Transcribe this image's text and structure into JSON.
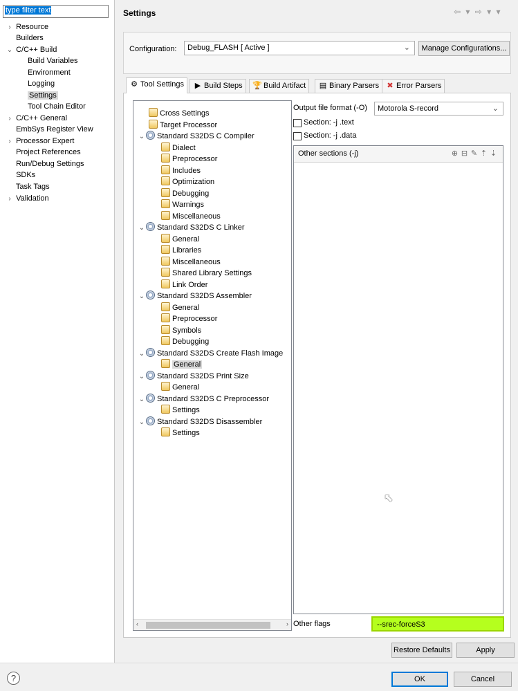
{
  "left_nav": {
    "filter": {
      "value": "type filter text"
    },
    "items": [
      {
        "label": "Resource",
        "chevron": "›"
      },
      {
        "label": "Builders",
        "chevron": ""
      },
      {
        "label": "C/C++ Build",
        "chevron": "⌄"
      },
      {
        "label": "Build Variables",
        "chevron": ""
      },
      {
        "label": "Environment",
        "chevron": ""
      },
      {
        "label": "Logging",
        "chevron": ""
      },
      {
        "label": "Settings",
        "chevron": ""
      },
      {
        "label": "Tool Chain Editor",
        "chevron": ""
      },
      {
        "label": "C/C++ General",
        "chevron": "›"
      },
      {
        "label": "EmbSys Register View",
        "chevron": ""
      },
      {
        "label": "Processor Expert",
        "chevron": "›"
      },
      {
        "label": "Project References",
        "chevron": ""
      },
      {
        "label": "Run/Debug Settings",
        "chevron": ""
      },
      {
        "label": "SDKs",
        "chevron": ""
      },
      {
        "label": "Task Tags",
        "chevron": ""
      },
      {
        "label": "Validation",
        "chevron": "›"
      }
    ]
  },
  "header": {
    "title": "Settings",
    "nav_arrows": "⇦ ▾ ⇨ ▾ ▾"
  },
  "configuration": {
    "label": "Configuration:",
    "value": "Debug_FLASH  [ Active ]",
    "caret": "⌄",
    "manage_label": "Manage Configurations..."
  },
  "tabs": [
    {
      "label": "Tool Settings",
      "icon": "⚙"
    },
    {
      "label": "Build Steps",
      "icon": "▶"
    },
    {
      "label": "Build Artifact",
      "icon": "🏆"
    },
    {
      "label": "Binary Parsers",
      "icon": "▤"
    },
    {
      "label": "Error Parsers",
      "icon": "✖"
    }
  ],
  "tree": {
    "rows": [
      {
        "label": "Cross Settings",
        "chevron": ""
      },
      {
        "label": "Target Processor",
        "chevron": ""
      },
      {
        "label": "Standard S32DS C Compiler",
        "chevron": "⌄"
      },
      {
        "label": "Dialect",
        "chevron": ""
      },
      {
        "label": "Preprocessor",
        "chevron": ""
      },
      {
        "label": "Includes",
        "chevron": ""
      },
      {
        "label": "Optimization",
        "chevron": ""
      },
      {
        "label": "Debugging",
        "chevron": ""
      },
      {
        "label": "Warnings",
        "chevron": ""
      },
      {
        "label": "Miscellaneous",
        "chevron": ""
      },
      {
        "label": "Standard S32DS C Linker",
        "chevron": "⌄"
      },
      {
        "label": "General",
        "chevron": ""
      },
      {
        "label": "Libraries",
        "chevron": ""
      },
      {
        "label": "Miscellaneous",
        "chevron": ""
      },
      {
        "label": "Shared Library Settings",
        "chevron": ""
      },
      {
        "label": "Link Order",
        "chevron": ""
      },
      {
        "label": "Standard S32DS Assembler",
        "chevron": "⌄"
      },
      {
        "label": "General",
        "chevron": ""
      },
      {
        "label": "Preprocessor",
        "chevron": ""
      },
      {
        "label": "Symbols",
        "chevron": ""
      },
      {
        "label": "Debugging",
        "chevron": ""
      },
      {
        "label": "Standard S32DS Create Flash Image",
        "chevron": "⌄"
      },
      {
        "label": "General",
        "chevron": ""
      },
      {
        "label": "Standard S32DS Print Size",
        "chevron": "⌄"
      },
      {
        "label": "General",
        "chevron": ""
      },
      {
        "label": "Standard S32DS C Preprocessor",
        "chevron": "⌄"
      },
      {
        "label": "Settings",
        "chevron": ""
      },
      {
        "label": "Standard S32DS Disassembler",
        "chevron": "⌄"
      },
      {
        "label": "Settings",
        "chevron": ""
      }
    ],
    "scroll_left": "‹",
    "scroll_right": "›"
  },
  "options": {
    "output_format_label": "Output file format (-O)",
    "output_format_value": "Motorola S-record",
    "caret": "⌄",
    "section_text_label": "Section: -j .text",
    "section_data_label": "Section: -j .data",
    "other_sections_label": "Other sections (-j)",
    "other_flags_label": "Other flags",
    "other_flags_value": "--srec-forceS3"
  },
  "buttons": {
    "restore_defaults": "Restore Defaults",
    "apply": "Apply",
    "ok": "OK",
    "cancel": "Cancel",
    "help": "?"
  },
  "colors": {
    "highlight": "#b5ff1e",
    "selection": "#0078d7"
  }
}
